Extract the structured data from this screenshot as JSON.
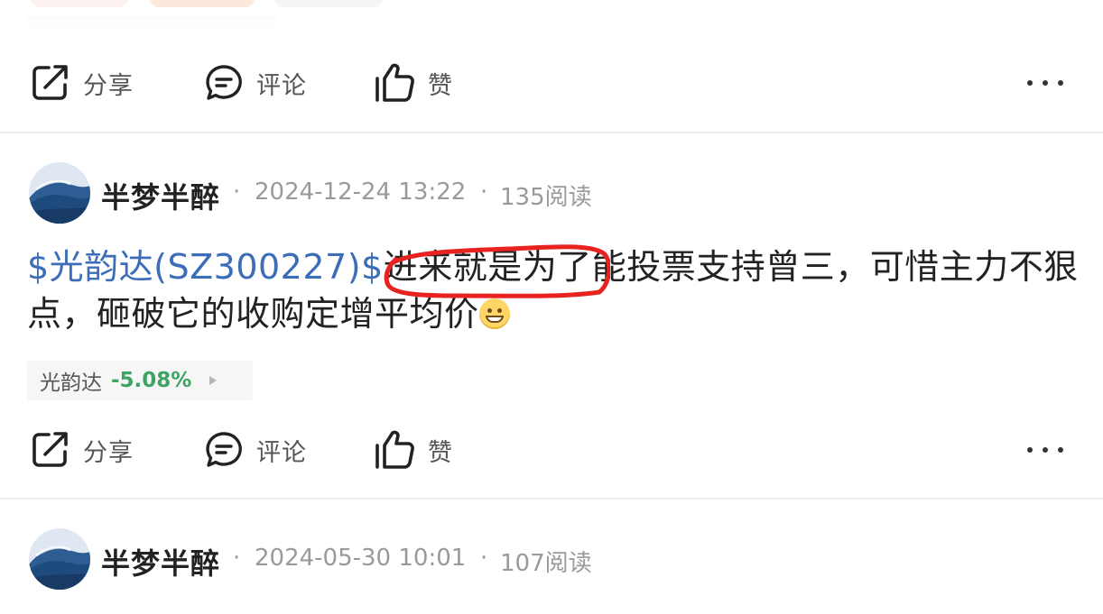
{
  "actions_bar_1": {
    "share_label": "分享",
    "comment_label": "评论",
    "like_label": "赞"
  },
  "post_1": {
    "author": "半梦半醉",
    "separator": "·",
    "timestamp": "2024-12-24 13:22",
    "reads": "135阅读",
    "stock_link_text": "$光韵达(SZ300227)$",
    "content": "进来就是为了能投票支持曾三，可惜主力不狠点，砸破它的收购定增平均价",
    "stock_tag": {
      "name": "光韵达",
      "change": "-5.08%",
      "change_color": "#3ea363"
    },
    "actions": {
      "share_label": "分享",
      "comment_label": "评论",
      "like_label": "赞"
    }
  },
  "post_2": {
    "author": "半梦半醉",
    "separator": "·",
    "timestamp": "2024-05-30 10:01",
    "reads": "107阅读"
  },
  "colors": {
    "link": "#3b6db8",
    "annotation": "#e8231f",
    "stock_down": "#3ea363"
  },
  "icons": [
    "share-icon",
    "comment-icon",
    "thumbs-up-icon",
    "more-icon",
    "emoji-grin-icon",
    "caret-right-icon"
  ]
}
